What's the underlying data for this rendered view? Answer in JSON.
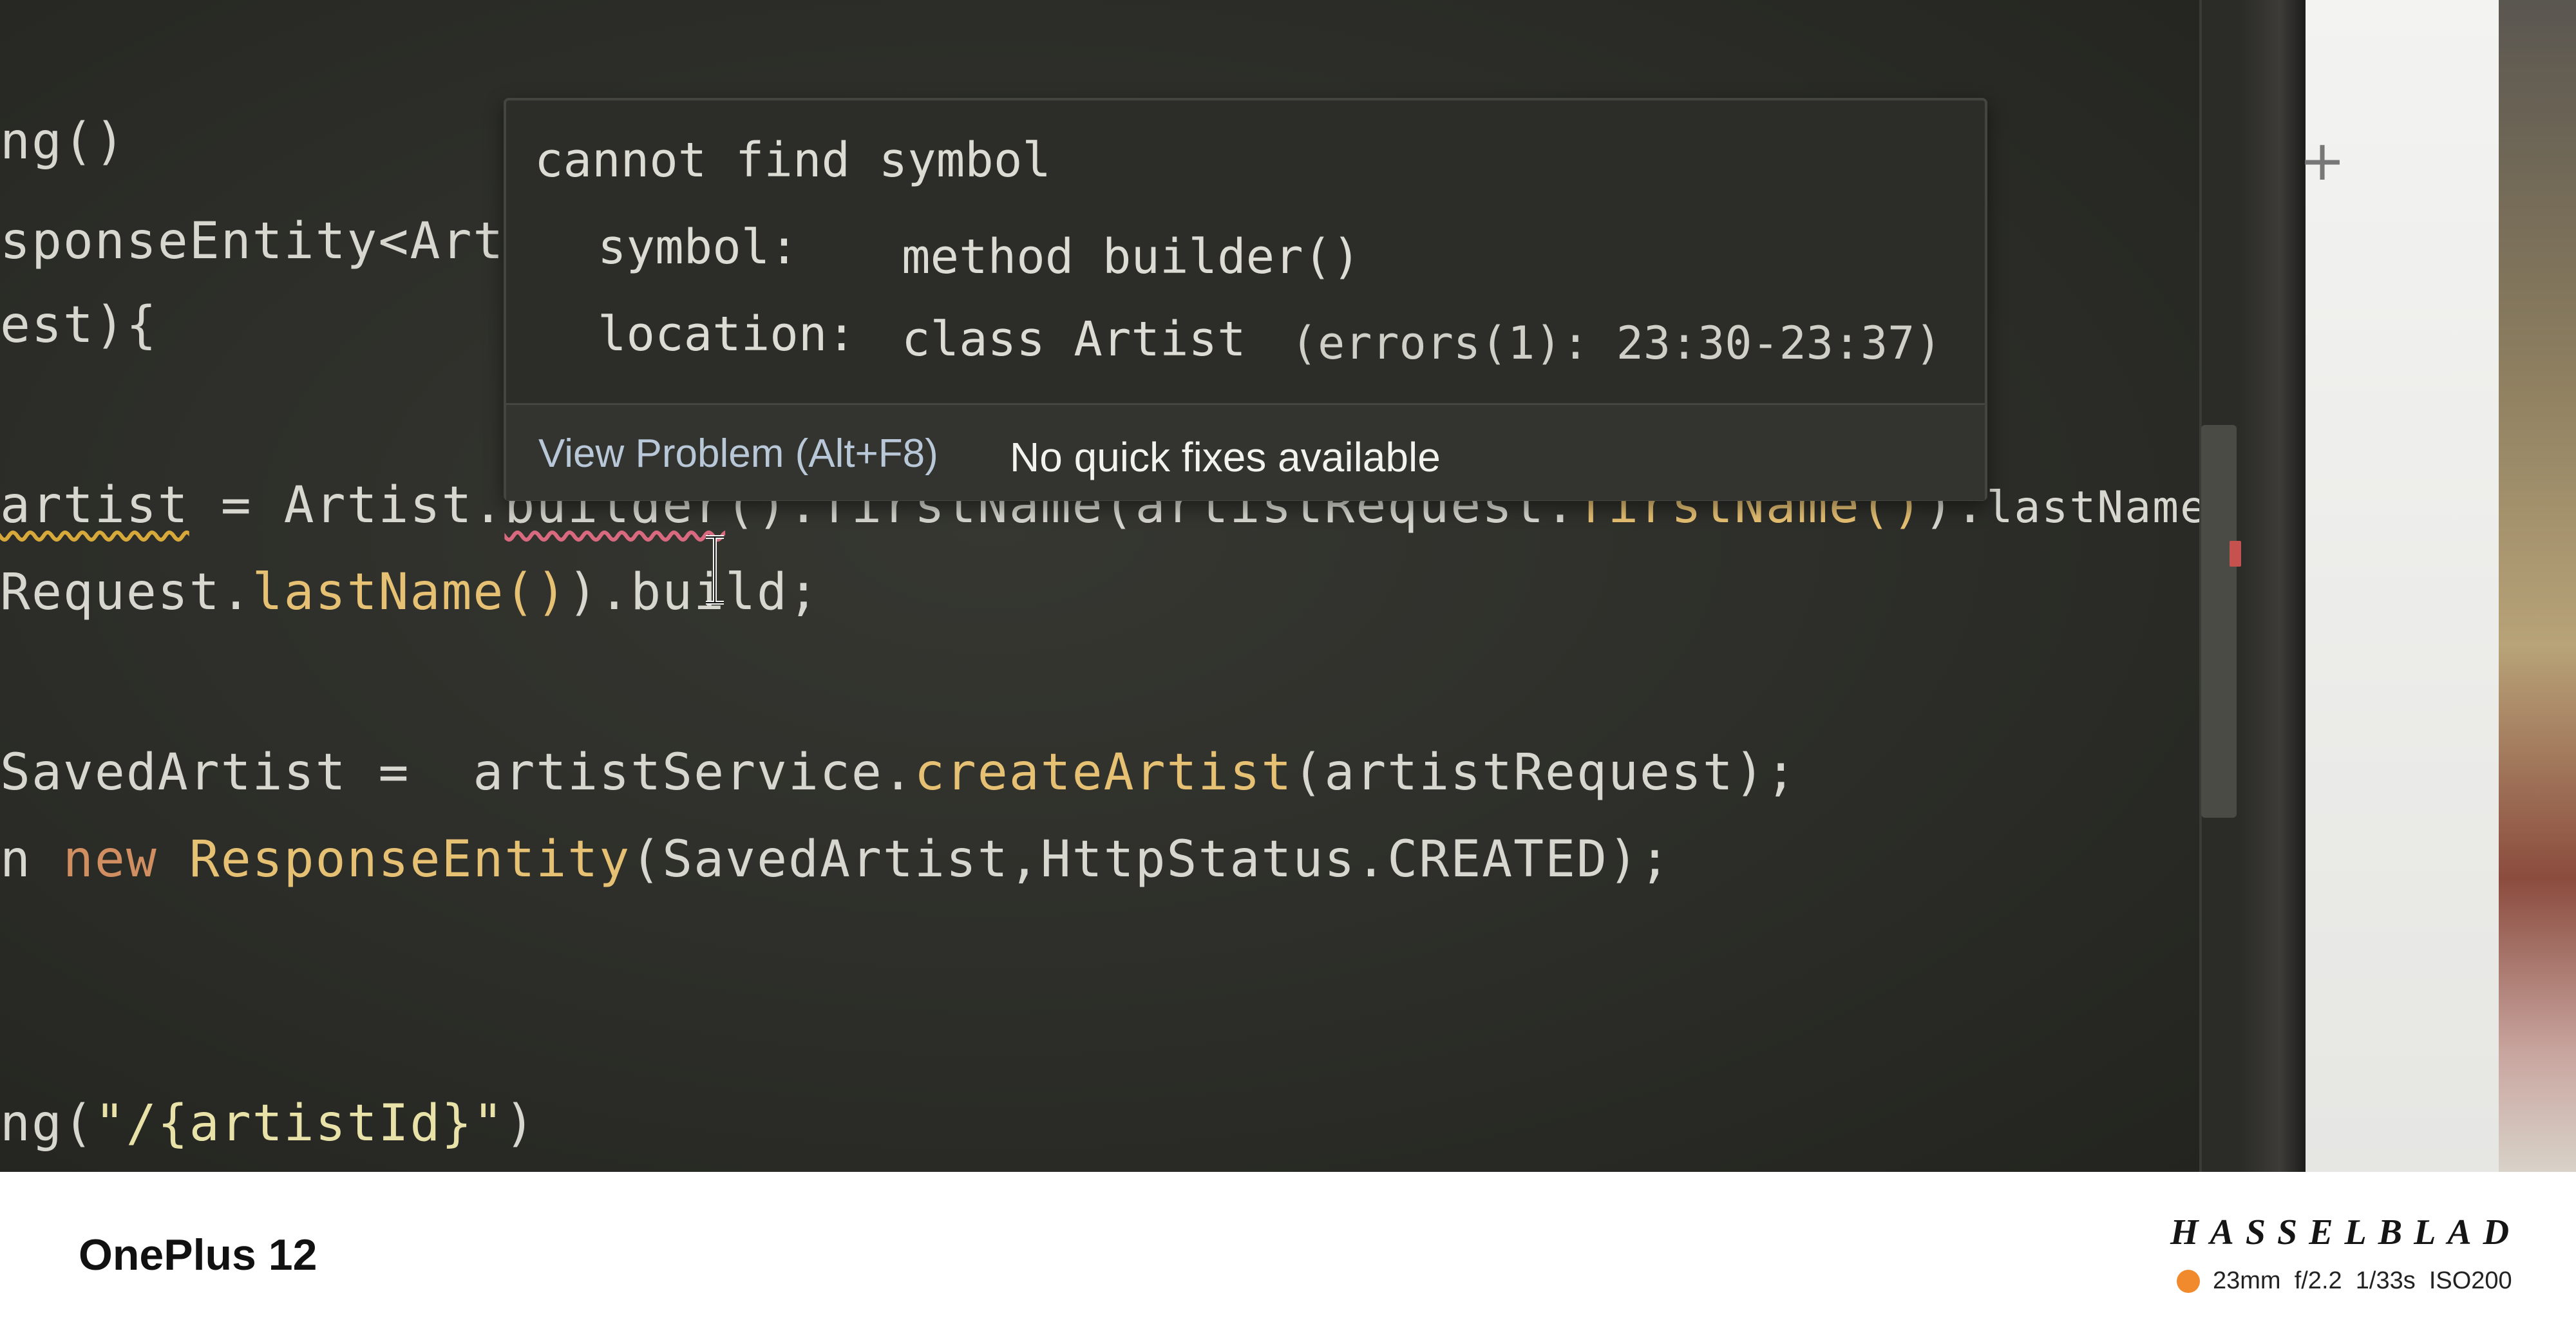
{
  "code": {
    "line1": {
      "text": "ng()"
    },
    "line2": {
      "text": "sponseEntity<Art"
    },
    "line3": {
      "text": "est){"
    },
    "line4": {
      "a": "artist",
      "b": " = Artist.",
      "c": "builder",
      "d": "().",
      "e": "firstName",
      "f": "(artistRequest.",
      "g": "firstName",
      "h": "()",
      "i": ").",
      "j": "lastName"
    },
    "line5": {
      "a": "Request.",
      "b": "lastName",
      "c": "()",
      "d": ").build;"
    },
    "line6": {
      "a": "SavedArtist =  artistService.",
      "b": "createArtist",
      "c": "(artistRequest);"
    },
    "line7": {
      "a": "n ",
      "b": "new",
      "c": " ",
      "d": "ResponseEntity",
      "e": "(SavedArtist,HttpStatus.CREATED);"
    },
    "line8": {
      "a": "ng(",
      "b": "\"/{artistId}\"",
      "c": ")"
    }
  },
  "tooltip": {
    "title": "cannot find symbol",
    "symbol_label": "symbol:",
    "symbol_value": "method builder()",
    "location_label": "location:",
    "location_value": "class Artist",
    "errors_text": "(errors(1): 23:30-23:37)",
    "view_problem_label": "View Problem (Alt+F8)",
    "no_fixes_label": "No quick fixes available"
  },
  "side_panel": {
    "icon": "plus-icon"
  },
  "watermark": {
    "device": "OnePlus 12",
    "brand": "HASSELBLAD",
    "exif": "23mm  f/2.2  1/33s  ISO200",
    "dot_color": "#f08a2c"
  }
}
